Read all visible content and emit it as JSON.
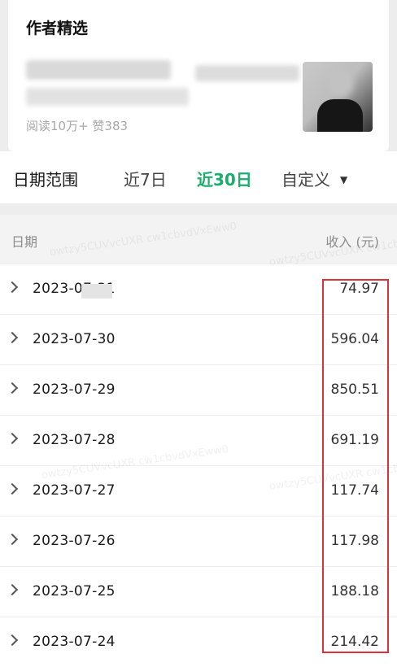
{
  "author_picks": {
    "title": "作者精选",
    "stats": "阅读10万+ 赞383"
  },
  "date_range": {
    "label": "日期范围",
    "options": [
      "近7日",
      "近30日",
      "自定义"
    ],
    "selected": "近30日"
  },
  "table": {
    "headers": {
      "date": "日期",
      "income": "收入 (元)"
    },
    "rows": [
      {
        "date": "2023-07-31",
        "income": "74.97"
      },
      {
        "date": "2023-07-30",
        "income": "596.04"
      },
      {
        "date": "2023-07-29",
        "income": "850.51"
      },
      {
        "date": "2023-07-28",
        "income": "691.19"
      },
      {
        "date": "2023-07-27",
        "income": "117.74"
      },
      {
        "date": "2023-07-26",
        "income": "117.98"
      },
      {
        "date": "2023-07-25",
        "income": "188.18"
      },
      {
        "date": "2023-07-24",
        "income": "214.42"
      }
    ]
  },
  "colors": {
    "accent_green": "#1aad6b",
    "highlight_red": "#e0303a"
  },
  "watermark": "owtzy5CUVvcUXR cw1cbvdVxEww0"
}
